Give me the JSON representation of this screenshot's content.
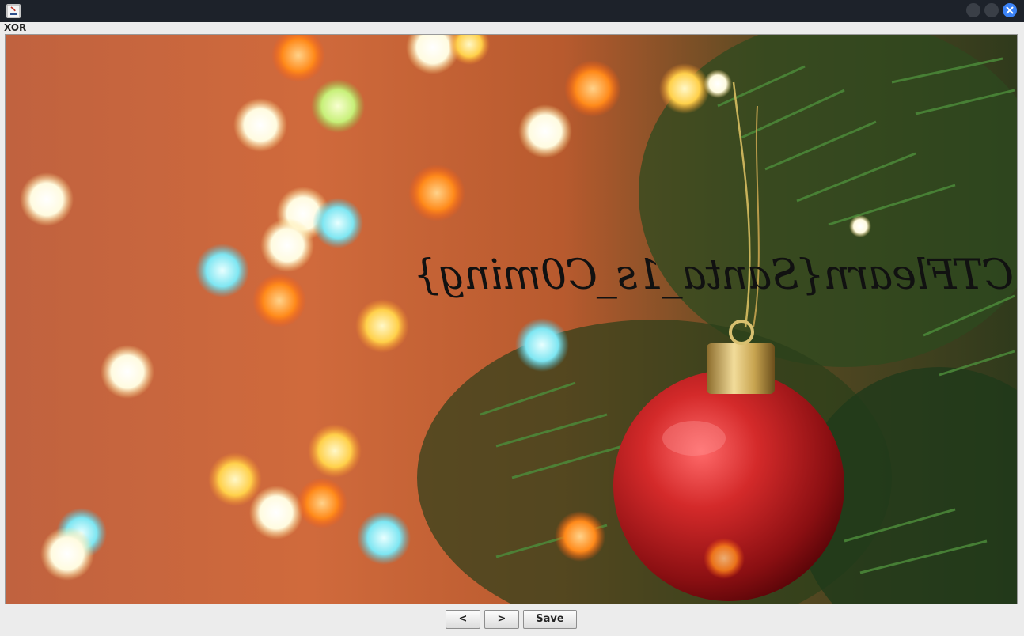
{
  "window": {
    "title_icon": "java-app-icon",
    "controls": [
      "minimize",
      "maximize",
      "close"
    ],
    "close_color": "#3b82f6"
  },
  "panel": {
    "label": "XOR"
  },
  "image": {
    "description_icon": "christmas-ornament-photo",
    "overlay_text": "CTFlearn{Santa_1s_C0ming}",
    "overlay_mirrored": true
  },
  "toolbar": {
    "prev_label": "<",
    "next_label": ">",
    "save_label": "Save"
  }
}
